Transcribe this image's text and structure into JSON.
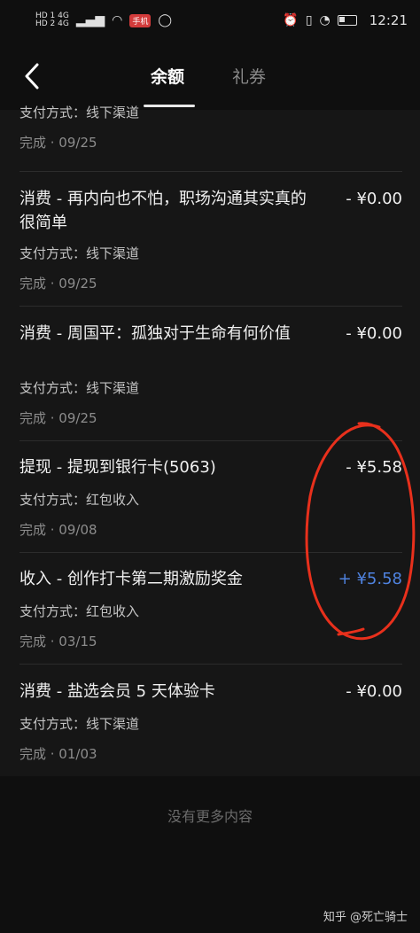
{
  "status_bar": {
    "left_top": "HD 1  4G",
    "left_bottom": "HD 2  4G",
    "app_badge": "手机",
    "time": "12:21"
  },
  "nav": {
    "back_icon": "chevron-left-icon",
    "tabs": [
      {
        "label": "余额",
        "active": true
      },
      {
        "label": "礼券",
        "active": false
      }
    ]
  },
  "items": [
    {
      "title": "",
      "amount": "",
      "payment": "支付方式：线下渠道",
      "meta": "完成 · 09/25"
    },
    {
      "title": "消费 - 再内向也不怕，职场沟通其实真的很简单",
      "amount": "- ¥0.00",
      "payment": "支付方式：线下渠道",
      "meta": "完成 · 09/25"
    },
    {
      "title": "消费 - 周国平：孤独对于生命有何价值",
      "amount": "- ¥0.00",
      "payment": "支付方式：线下渠道",
      "meta": "完成 · 09/25"
    },
    {
      "title": "提现 - 提现到银行卡(5063)",
      "amount": "- ¥5.58",
      "payment": "支付方式：红包收入",
      "meta": "完成 · 09/08"
    },
    {
      "title": "收入 - 创作打卡第二期激励奖金",
      "amount": "+ ¥5.58",
      "payment": "支付方式：红包收入",
      "meta": "完成 · 03/15"
    },
    {
      "title": "消费 - 盐选会员 5 天体验卡",
      "amount": "- ¥0.00",
      "payment": "支付方式：线下渠道",
      "meta": "完成 · 01/03"
    }
  ],
  "footer": {
    "no_more": "没有更多内容",
    "watermark": "知乎 @死亡骑士"
  },
  "colors": {
    "income": "#4f83e0",
    "annotation": "#e8301c"
  }
}
